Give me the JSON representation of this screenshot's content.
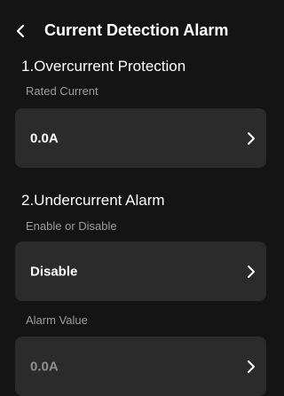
{
  "header": {
    "back_icon": "chevron-left-icon",
    "title": "Current Detection Alarm"
  },
  "overcurrent": {
    "section_title": "1.Overcurrent Protection",
    "rated_current_label": "Rated Current",
    "rated_current_value": "0.0A"
  },
  "undercurrent": {
    "section_title": "2.Undercurrent Alarm",
    "enable_label": "Enable or Disable",
    "enable_value": "Disable",
    "alarm_value_label": "Alarm Value",
    "alarm_value": "0.0A",
    "alarm_value_disabled": true
  },
  "colors": {
    "background": "#141414",
    "card": "#2b2b2b",
    "label_gray": "#9b9b9b",
    "text": "#ffffff"
  }
}
